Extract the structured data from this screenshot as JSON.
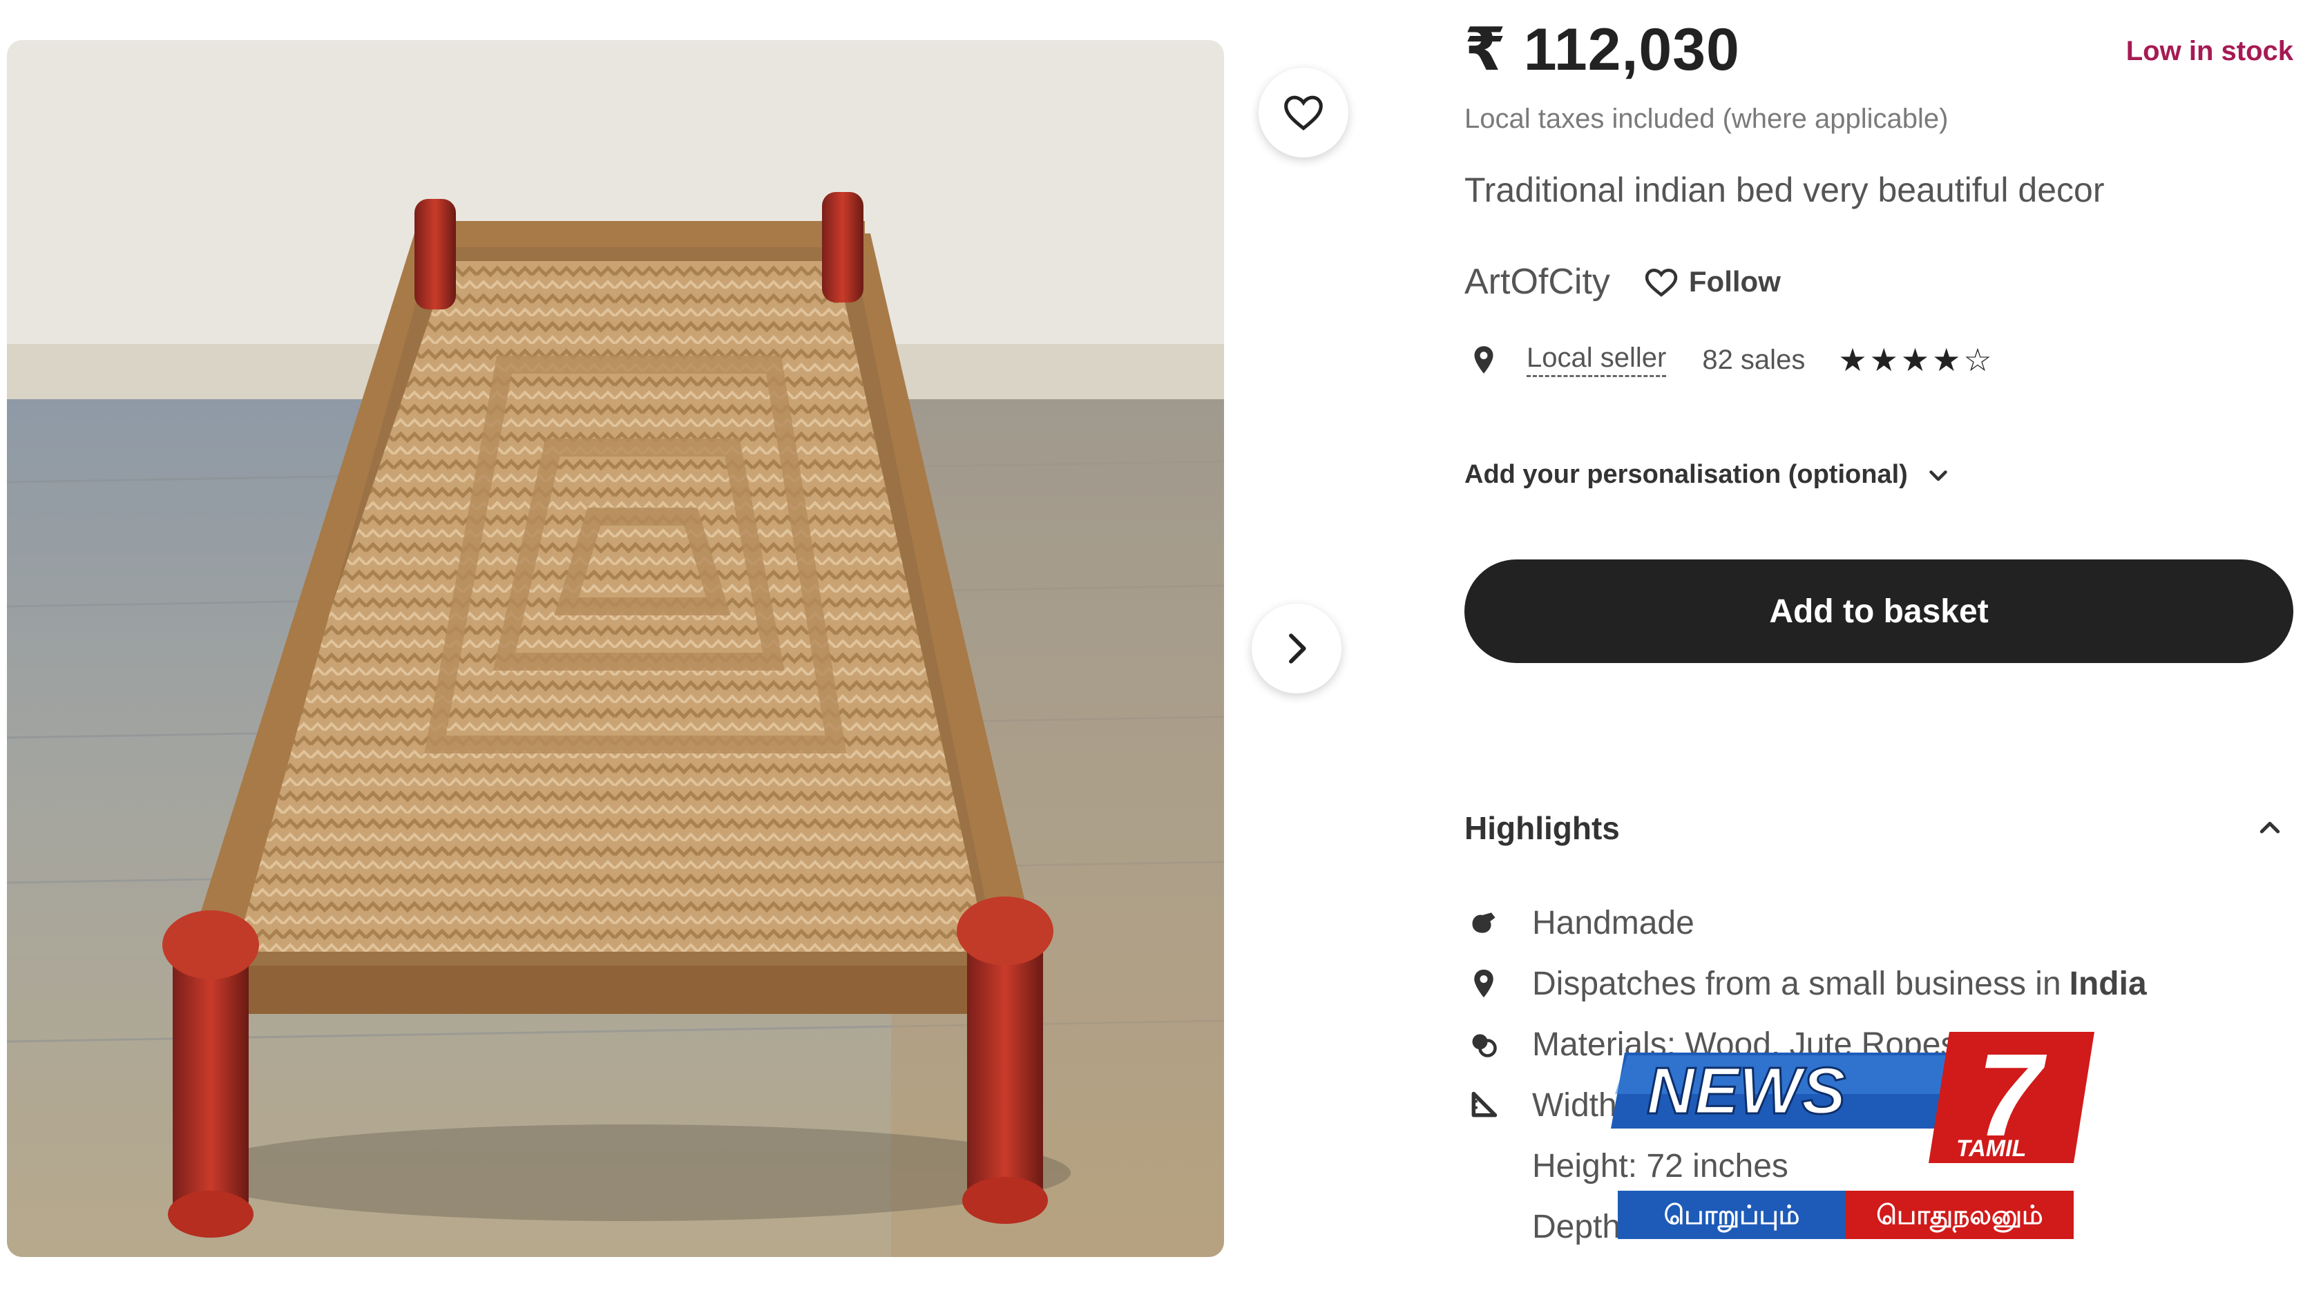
{
  "product": {
    "price": "₹ 112,030",
    "stock_status": "Low in stock",
    "taxes_note": "Local taxes included (where applicable)",
    "title": "Traditional indian bed very beautiful decor"
  },
  "seller": {
    "shop_name": "ArtOfCity",
    "follow_label": "Follow",
    "local_seller_label": "Local seller",
    "sales": "82 sales",
    "rating": 4,
    "rating_max": 5
  },
  "personalisation": {
    "label": "Add your personalisation (optional)"
  },
  "actions": {
    "add_to_basket": "Add to basket"
  },
  "highlights": {
    "title": "Highlights",
    "items": [
      {
        "icon": "handmade-icon",
        "text": "Handmade",
        "strong": ""
      },
      {
        "icon": "location-pin-icon",
        "text": "Dispatches from a small business in",
        "strong": "India"
      },
      {
        "icon": "materials-icon",
        "text": "Materials: Wood, Jute Ropes",
        "strong": ""
      },
      {
        "icon": "ruler-icon",
        "text": "Width",
        "strong": ""
      },
      {
        "icon": "",
        "text": "Height: 72 inches",
        "strong": ""
      },
      {
        "icon": "",
        "text": "Depth",
        "strong": ""
      }
    ]
  },
  "watermark": {
    "brand": "NEWS",
    "number": "7",
    "sub": "TAMIL",
    "tagline_left": "பொறுப்பும்",
    "tagline_right": "பொதுநலனும்"
  },
  "colors": {
    "stock_text": "#a61a53",
    "button_bg": "#222222",
    "logo_blue": "#1e5bb8",
    "logo_red": "#d11a1a"
  }
}
